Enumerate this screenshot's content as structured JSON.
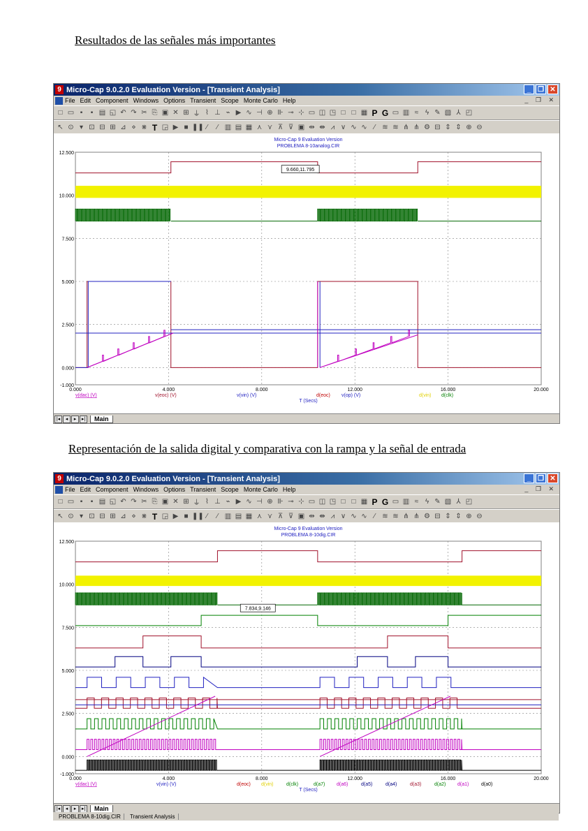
{
  "heading1": "Resultados de las señales más importantes",
  "heading2": "Representación de la salida digital y comparativa con la rampa y la señal de entrada",
  "window": {
    "title": "Micro-Cap 9.0.2.0 Evaluation Version - [Transient Analysis]",
    "app_icon": "9",
    "menu": [
      "File",
      "Edit",
      "Component",
      "Windows",
      "Options",
      "Transient",
      "Scope",
      "Monte Carlo",
      "Help"
    ],
    "min_icon": "minimize-icon",
    "max_icon": "maximize-icon",
    "close_icon": "close-icon",
    "toolbar_letters": [
      "P",
      "G"
    ],
    "tab_label": "Main"
  },
  "status": {
    "file": "PROBLEMA 8-10dig.CIR",
    "mode": "Transient Analysis"
  },
  "colors": {
    "yellow": "#f2f200",
    "dark_green": "#006600",
    "maroon": "#a0102a",
    "blue": "#2020c0",
    "magenta": "#c000c0",
    "green": "#008000",
    "grid": "#808080"
  },
  "plot1": {
    "header_line1": "Micro-Cap 9 Evaluation Version",
    "header_line2": "PROBLEMA 8-10analog.CIR",
    "cursor_label": "9.660,11.795",
    "x_axis_title": "T (Secs)",
    "chart_data": {
      "type": "line",
      "xlim": [
        0,
        20
      ],
      "ylim": [
        -1,
        12.5
      ],
      "y_ticks": [
        "12.500",
        "10.000",
        "7.500",
        "5.000",
        "2.500",
        "0.000",
        "-1.000"
      ],
      "x_ticks": [
        "0.000",
        "4.000",
        "8.000",
        "12.000",
        "16.000",
        "20.000"
      ],
      "legend": [
        {
          "label": "v(dac) (V)",
          "color": "#c000c0"
        },
        {
          "label": "v(eoc) (V)",
          "color": "#a0102a"
        },
        {
          "label": "v(vin) (V)",
          "color": "#2020c0"
        },
        {
          "label": "d(eoc)",
          "color": "#c00000"
        },
        {
          "label": "v(op) (V)",
          "color": "#2020c0"
        },
        {
          "label": "d(vin)",
          "color": "#e0d000"
        },
        {
          "label": "d(clk)",
          "color": "#008000"
        }
      ],
      "series": [
        {
          "name": "v(dac) (V)",
          "x": [
            0.5,
            4.2,
            10.5,
            14.7
          ],
          "y": [
            0,
            2.0,
            0,
            1.9
          ]
        },
        {
          "name": "v(eoc) (V)",
          "x": [
            0,
            0.5,
            0.5,
            4.1,
            4.1,
            10.4,
            10.4,
            14.7,
            14.7,
            20
          ],
          "y": [
            0,
            0,
            5,
            5,
            0,
            0,
            5,
            5,
            0,
            0
          ]
        },
        {
          "name": "v(vin) (V)",
          "x": [
            0,
            20
          ],
          "y": [
            2.0,
            2.0
          ]
        },
        {
          "name": "v(op) (V)",
          "x": [
            4.1,
            20
          ],
          "y": [
            2.2,
            2.2
          ]
        }
      ],
      "digital": [
        {
          "name": "d(eoc)",
          "transitions": [
            0,
            4.1,
            10.4,
            14.7
          ]
        },
        {
          "name": "d(vin)",
          "state": "unknown"
        },
        {
          "name": "d(clk)",
          "burst": [
            [
              0,
              4.1
            ],
            [
              10.4,
              14.7
            ]
          ]
        }
      ]
    }
  },
  "plot2": {
    "header_line1": "Micro-Cap 9 Evaluation Version",
    "header_line2": "PROBLEMA 8-10dig.CIR",
    "cursor_label": "7.834,9.146",
    "x_axis_title": "T (Secs)",
    "chart_data": {
      "type": "line",
      "xlim": [
        0,
        20
      ],
      "ylim": [
        -1,
        12.5
      ],
      "y_ticks": [
        "12.500",
        "10.000",
        "7.500",
        "5.000",
        "2.500",
        "0.000",
        "-1.000"
      ],
      "x_ticks": [
        "0.000",
        "4.000",
        "8.000",
        "12.000",
        "16.000",
        "20.000"
      ],
      "legend": [
        {
          "label": "v(dac) (V)",
          "color": "#c000c0"
        },
        {
          "label": "v(vin) (V)",
          "color": "#2020c0"
        },
        {
          "label": "d(eoc)",
          "color": "#c00000"
        },
        {
          "label": "d(vin)",
          "color": "#e0d000"
        },
        {
          "label": "d(clk)",
          "color": "#008000"
        },
        {
          "label": "d(a7)",
          "color": "#008000"
        },
        {
          "label": "d(a6)",
          "color": "#c000c0"
        },
        {
          "label": "d(a5)",
          "color": "#000080"
        },
        {
          "label": "d(a4)",
          "color": "#000080"
        },
        {
          "label": "d(a3)",
          "color": "#a0102a"
        },
        {
          "label": "d(a2)",
          "color": "#008000"
        },
        {
          "label": "d(a1)",
          "color": "#c000c0"
        },
        {
          "label": "d(a0)",
          "color": "#000000"
        }
      ],
      "series": [
        {
          "name": "v(dac) (V)",
          "x": [
            0.5,
            6.0,
            10.5,
            16.1
          ],
          "y": [
            0,
            3.5,
            0,
            3.5
          ]
        },
        {
          "name": "v(vin) (V)",
          "x": [
            0,
            20
          ],
          "y": [
            3.1,
            3.1
          ]
        }
      ]
    }
  }
}
